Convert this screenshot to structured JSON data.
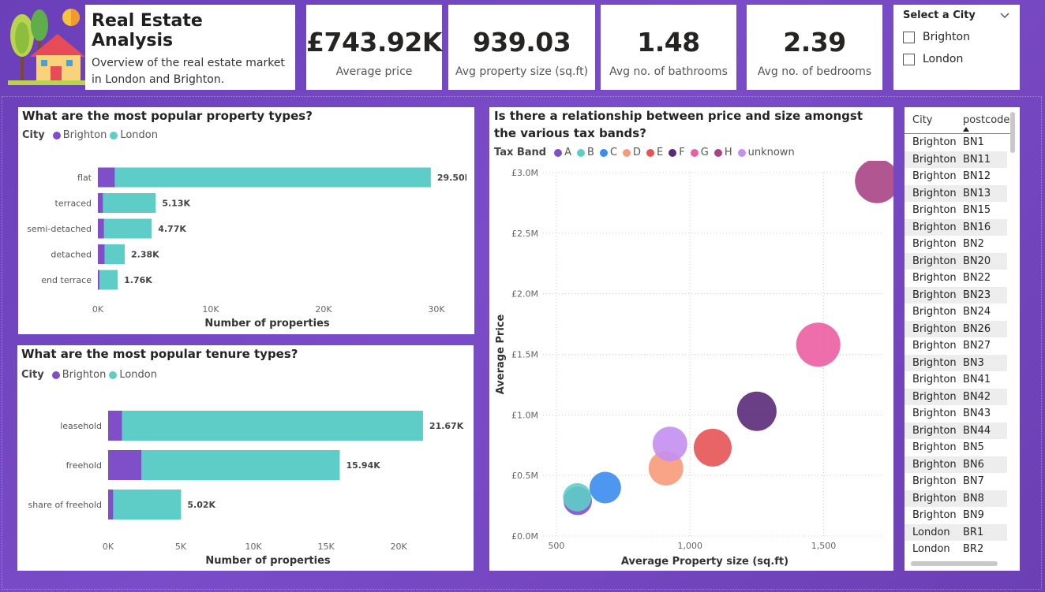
{
  "header": {
    "title": "Real Estate Analysis",
    "subtitle": "Overview of the real estate market in London and Brighton.",
    "logo_icon": "house-tree-sun-icon"
  },
  "kpis": [
    {
      "value": "£743.92K",
      "label": "Average price"
    },
    {
      "value": "939.03",
      "label": "Avg property size (sq.ft)"
    },
    {
      "value": "1.48",
      "label": "Avg no. of bathrooms"
    },
    {
      "value": "2.39",
      "label": "Avg no. of bedrooms"
    }
  ],
  "slicer": {
    "title": "Select a City",
    "options": [
      "Brighton",
      "London"
    ],
    "chevron_icon": "chevron-down-icon"
  },
  "colors": {
    "brighton": "#7f4fc9",
    "london": "#5ecdc8",
    "background": "#6a3fb8"
  },
  "property_chart": {
    "title": "What are the most popular property types?",
    "legend_title": "City",
    "xlabel": "Number of properties"
  },
  "tenure_chart": {
    "title": "What are the most popular tenure types?",
    "legend_title": "City",
    "xlabel": "Number of properties"
  },
  "scatter_chart": {
    "title": "Is there a relationship between price and size amongst the various tax bands?",
    "legend_title": "Tax Band",
    "xlabel": "Average Property size (sq.ft)",
    "ylabel": "Average Price"
  },
  "chart_data": [
    {
      "type": "bar",
      "orientation": "horizontal",
      "stacked": true,
      "title": "What are the most popular property types?",
      "categories": [
        "flat",
        "terraced",
        "semi-detached",
        "detached",
        "end terrace"
      ],
      "series": [
        {
          "name": "Brighton",
          "values": [
            1500,
            450,
            550,
            600,
            150
          ],
          "color": "#7f4fc9"
        },
        {
          "name": "London",
          "values": [
            28000,
            4680,
            4220,
            1780,
            1610
          ],
          "color": "#5ecdc8"
        }
      ],
      "totals": [
        "29.50K",
        "5.13K",
        "4.77K",
        "2.38K",
        "1.76K"
      ],
      "xlim": [
        0,
        30000
      ],
      "xticks": [
        0,
        10000,
        20000,
        30000
      ],
      "xtick_labels": [
        "0K",
        "10K",
        "20K",
        "30K"
      ],
      "xlabel": "Number of properties"
    },
    {
      "type": "bar",
      "orientation": "horizontal",
      "stacked": true,
      "title": "What are the most popular tenure types?",
      "categories": [
        "leasehold",
        "freehold",
        "share of freehold"
      ],
      "series": [
        {
          "name": "Brighton",
          "values": [
            950,
            2300,
            350
          ],
          "color": "#7f4fc9"
        },
        {
          "name": "London",
          "values": [
            20720,
            13640,
            4670
          ],
          "color": "#5ecdc8"
        }
      ],
      "totals": [
        "21.67K",
        "15.94K",
        "5.02K"
      ],
      "xlim": [
        0,
        22000
      ],
      "xticks": [
        0,
        5000,
        10000,
        15000,
        20000
      ],
      "xtick_labels": [
        "0K",
        "5K",
        "10K",
        "15K",
        "20K"
      ],
      "xlabel": "Number of properties"
    },
    {
      "type": "scatter",
      "title": "Is there a relationship between price and size amongst the various tax bands?",
      "xlabel": "Average Property size (sq.ft)",
      "ylabel": "Average Price",
      "xlim": [
        450,
        1720
      ],
      "ylim": [
        0,
        3000000
      ],
      "xticks": [
        500,
        1000,
        1500
      ],
      "xtick_labels": [
        "500",
        "1,000",
        "1,500"
      ],
      "yticks": [
        0,
        500000,
        1000000,
        1500000,
        2000000,
        2500000,
        3000000
      ],
      "ytick_labels": [
        "£0.0M",
        "£0.5M",
        "£1.0M",
        "£1.5M",
        "£2.0M",
        "£2.5M",
        "£3.0M"
      ],
      "grid": true,
      "legend_position": "top-left",
      "series": [
        {
          "name": "A",
          "x": 580,
          "y": 290000,
          "color": "#7f4fc9",
          "size": 18
        },
        {
          "name": "B",
          "x": 578,
          "y": 320000,
          "color": "#5ecdc8",
          "size": 18
        },
        {
          "name": "C",
          "x": 683,
          "y": 400000,
          "color": "#3b8cf0",
          "size": 20
        },
        {
          "name": "D",
          "x": 910,
          "y": 560000,
          "color": "#f79a7a",
          "size": 22
        },
        {
          "name": "E",
          "x": 1085,
          "y": 730000,
          "color": "#e45454",
          "size": 24
        },
        {
          "name": "F",
          "x": 1250,
          "y": 1030000,
          "color": "#5a2a78",
          "size": 25
        },
        {
          "name": "G",
          "x": 1480,
          "y": 1580000,
          "color": "#ec5ea2",
          "size": 28
        },
        {
          "name": "H",
          "x": 1700,
          "y": 2930000,
          "color": "#a84484",
          "size": 28
        },
        {
          "name": "unknown",
          "x": 925,
          "y": 760000,
          "color": "#c48ff2",
          "size": 22
        }
      ]
    }
  ],
  "table": {
    "columns": [
      "City",
      "postcode"
    ],
    "rows": [
      [
        "Brighton",
        "BN1"
      ],
      [
        "Brighton",
        "BN11"
      ],
      [
        "Brighton",
        "BN12"
      ],
      [
        "Brighton",
        "BN13"
      ],
      [
        "Brighton",
        "BN15"
      ],
      [
        "Brighton",
        "BN16"
      ],
      [
        "Brighton",
        "BN2"
      ],
      [
        "Brighton",
        "BN20"
      ],
      [
        "Brighton",
        "BN22"
      ],
      [
        "Brighton",
        "BN23"
      ],
      [
        "Brighton",
        "BN24"
      ],
      [
        "Brighton",
        "BN26"
      ],
      [
        "Brighton",
        "BN27"
      ],
      [
        "Brighton",
        "BN3"
      ],
      [
        "Brighton",
        "BN41"
      ],
      [
        "Brighton",
        "BN42"
      ],
      [
        "Brighton",
        "BN43"
      ],
      [
        "Brighton",
        "BN44"
      ],
      [
        "Brighton",
        "BN5"
      ],
      [
        "Brighton",
        "BN6"
      ],
      [
        "Brighton",
        "BN7"
      ],
      [
        "Brighton",
        "BN8"
      ],
      [
        "Brighton",
        "BN9"
      ],
      [
        "London",
        "BR1"
      ],
      [
        "London",
        "BR2"
      ]
    ]
  }
}
